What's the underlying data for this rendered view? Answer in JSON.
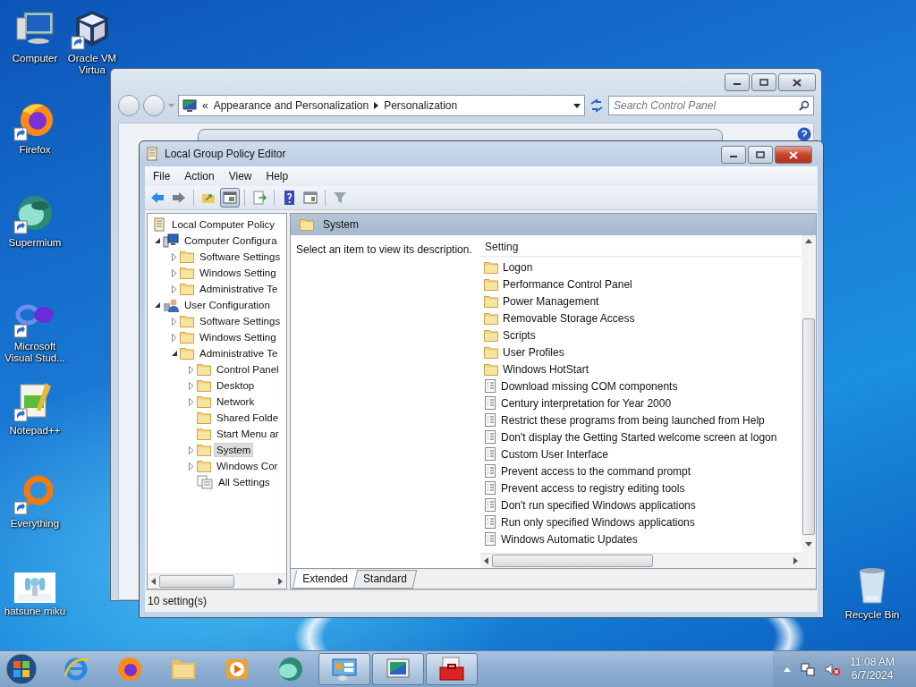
{
  "desktop_icons": [
    {
      "label": "Computer",
      "kind": "computer",
      "shortcut": false
    },
    {
      "label": "Oracle VM Virtua",
      "kind": "cube",
      "shortcut": true
    },
    {
      "label": "Firefox",
      "kind": "firefox",
      "shortcut": true
    },
    {
      "label": "Supermium",
      "kind": "sphere",
      "shortcut": true
    },
    {
      "label": "Microsoft Visual Stud...",
      "kind": "infinity",
      "shortcut": true
    },
    {
      "label": "Notepad++",
      "kind": "notepad",
      "shortcut": true
    },
    {
      "label": "Everything",
      "kind": "ring",
      "shortcut": true
    },
    {
      "label": "hatsune miku",
      "kind": "picture",
      "shortcut": false
    },
    {
      "label": "Recycle Bin",
      "kind": "bin",
      "shortcut": false
    }
  ],
  "control_panel_window": {
    "chevron": "«",
    "breadcrumbs": [
      "Appearance and Personalization",
      "Personalization"
    ],
    "search": {
      "placeholder": "Search Control Panel"
    }
  },
  "policy_window": {
    "title": "Local Group Policy Editor",
    "menu": [
      "File",
      "Action",
      "View",
      "Help"
    ],
    "toolbar": [
      {
        "kind": "back",
        "pressed": false
      },
      {
        "kind": "forward",
        "pressed": false
      },
      {
        "kind": "sep"
      },
      {
        "kind": "up",
        "pressed": false
      },
      {
        "kind": "tree",
        "pressed": true
      },
      {
        "kind": "sep"
      },
      {
        "kind": "export",
        "pressed": false
      },
      {
        "kind": "sep"
      },
      {
        "kind": "help",
        "pressed": false
      },
      {
        "kind": "pane",
        "pressed": false
      },
      {
        "kind": "sep"
      },
      {
        "kind": "filter",
        "pressed": false
      }
    ],
    "tree": [
      {
        "label": "Local Computer Policy",
        "kind": "policy",
        "selected": false,
        "children": [
          {
            "label": "Computer Configura",
            "kind": "computer",
            "expanded": true,
            "selected": false,
            "children": [
              {
                "label": "Software Settings",
                "kind": "folder",
                "expanded": false,
                "selected": false
              },
              {
                "label": "Windows Setting",
                "kind": "folder",
                "expanded": false,
                "selected": false
              },
              {
                "label": "Administrative Te",
                "kind": "folder",
                "expanded": false,
                "selected": false
              }
            ]
          },
          {
            "label": "User Configuration",
            "kind": "user",
            "expanded": true,
            "selected": false,
            "children": [
              {
                "label": "Software Settings",
                "kind": "folder",
                "expanded": false,
                "selected": false
              },
              {
                "label": "Windows Setting",
                "kind": "folder",
                "expanded": false,
                "selected": false
              },
              {
                "label": "Administrative Te",
                "kind": "folder",
                "expanded": true,
                "selected": false,
                "children": [
                  {
                    "label": "Control Panel",
                    "kind": "folder",
                    "expanded": false,
                    "selected": false
                  },
                  {
                    "label": "Desktop",
                    "kind": "folder",
                    "expanded": false,
                    "selected": false
                  },
                  {
                    "label": "Network",
                    "kind": "folder",
                    "expanded": false,
                    "selected": false
                  },
                  {
                    "label": "Shared Folde",
                    "kind": "folder",
                    "selected": false
                  },
                  {
                    "label": "Start Menu ar",
                    "kind": "folder",
                    "selected": false
                  },
                  {
                    "label": "System",
                    "kind": "folder",
                    "expanded": false,
                    "selected": true
                  },
                  {
                    "label": "Windows Cor",
                    "kind": "folder",
                    "expanded": false,
                    "selected": false
                  },
                  {
                    "label": "All Settings",
                    "kind": "settings",
                    "selected": false
                  }
                ]
              }
            ]
          }
        ]
      }
    ],
    "header": "System",
    "description": "Select an item to view its description.",
    "column": "Setting",
    "settings": [
      {
        "label": "Logon",
        "kind": "folder"
      },
      {
        "label": "Performance Control Panel",
        "kind": "folder"
      },
      {
        "label": "Power Management",
        "kind": "folder"
      },
      {
        "label": "Removable Storage Access",
        "kind": "folder"
      },
      {
        "label": "Scripts",
        "kind": "folder"
      },
      {
        "label": "User Profiles",
        "kind": "folder"
      },
      {
        "label": "Windows HotStart",
        "kind": "folder"
      },
      {
        "label": "Download missing COM components",
        "kind": "policy"
      },
      {
        "label": "Century interpretation for Year 2000",
        "kind": "policy"
      },
      {
        "label": "Restrict these programs from being launched from Help",
        "kind": "policy"
      },
      {
        "label": "Don't display the Getting Started welcome screen at logon",
        "kind": "policy"
      },
      {
        "label": "Custom User Interface",
        "kind": "policy"
      },
      {
        "label": "Prevent access to the command prompt",
        "kind": "policy"
      },
      {
        "label": "Prevent access to registry editing tools",
        "kind": "policy"
      },
      {
        "label": "Don't run specified Windows applications",
        "kind": "policy"
      },
      {
        "label": "Run only specified Windows applications",
        "kind": "policy"
      },
      {
        "label": "Windows Automatic Updates",
        "kind": "policy"
      }
    ],
    "tabs": [
      {
        "label": "Extended",
        "selected": true
      },
      {
        "label": "Standard",
        "selected": false
      }
    ],
    "status": "10 setting(s)"
  },
  "taskbar": {
    "items": [
      {
        "kind": "ie",
        "running": false
      },
      {
        "kind": "firefox",
        "running": false
      },
      {
        "kind": "explorer",
        "running": false
      },
      {
        "kind": "media",
        "running": false
      },
      {
        "kind": "sphere",
        "running": false
      },
      {
        "kind": "control",
        "running": true
      },
      {
        "kind": "display",
        "running": true
      },
      {
        "kind": "toolbox",
        "running": true
      }
    ],
    "time": "11:08 AM",
    "date": "6/7/2024"
  }
}
